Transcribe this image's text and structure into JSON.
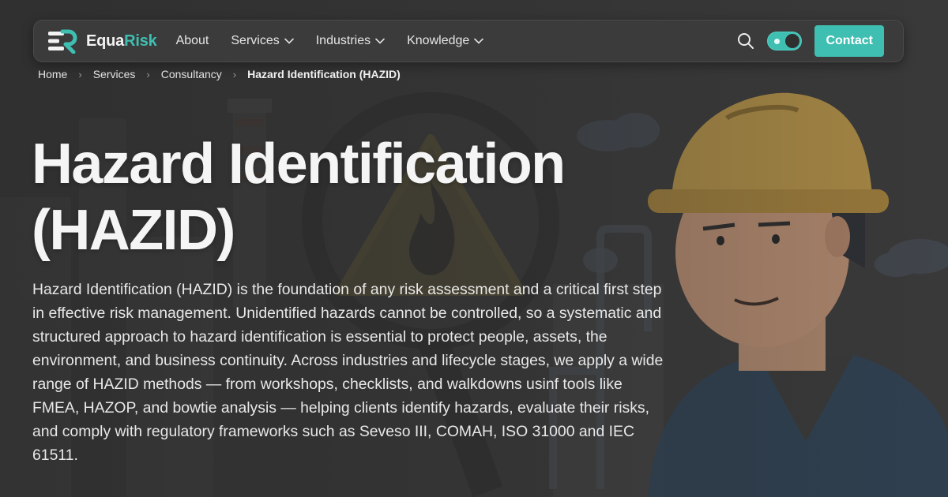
{
  "nav": {
    "brand_primary": "Equa",
    "brand_accent": "Risk",
    "links": [
      {
        "label": "About",
        "has_dropdown": false
      },
      {
        "label": "Services",
        "has_dropdown": true
      },
      {
        "label": "Industries",
        "has_dropdown": true
      },
      {
        "label": "Knowledge",
        "has_dropdown": true
      }
    ],
    "contact_label": "Contact",
    "theme_toggle_on": true
  },
  "breadcrumb": [
    "Home",
    "Services",
    "Consultancy",
    "Hazard Identification (HAZID)"
  ],
  "hero": {
    "title_line1": "Hazard Identification",
    "title_line2": "(HAZID)",
    "description": "Hazard Identification (HAZID) is the foundation of any risk assessment and a critical first step in effective risk management. Unidentified hazards cannot be controlled, so a systematic and structured approach to hazard identification is essential to protect people, assets, the environment, and business continuity. Across industries and lifecycle stages, we apply a wide range of HAZID methods — from workshops, checklists, and walkdowns usinf tools like FMEA, HAZOP, and bowtie analysis — helping clients identify hazards, evaluate their risks, and comply with regulatory frameworks such as Seveso III, COMAH, ISO 31000 and IEC 61511."
  },
  "icons": {
    "logo": "equarisk-logo-icon",
    "search": "search-icon",
    "dropdown": "chevron-down-icon",
    "breadcrumb_separator": "chevron-right-icon"
  },
  "colors": {
    "accent": "#3fbfb2",
    "background": "#3a3a3a",
    "text": "#ececec"
  }
}
